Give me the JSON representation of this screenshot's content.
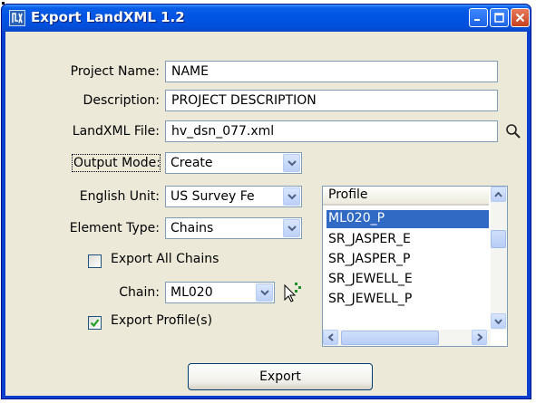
{
  "window": {
    "title": "Export LandXML 1.2"
  },
  "form": {
    "project_name": {
      "label": "Project Name:",
      "value": "NAME"
    },
    "description": {
      "label": "Description:",
      "value": "PROJECT DESCRIPTION"
    },
    "landxml_file": {
      "label": "LandXML File:",
      "value": "hv_dsn_077.xml"
    },
    "output_mode": {
      "label": "Output Mode:",
      "value": "Create"
    },
    "english_unit": {
      "label": "English Unit:",
      "value": "US Survey Fe"
    },
    "element_type": {
      "label": "Element Type:",
      "value": "Chains"
    },
    "export_all_chains": {
      "label": "Export All Chains",
      "checked": false
    },
    "chain": {
      "label": "Chain:",
      "value": "ML020"
    },
    "export_profiles": {
      "label": "Export Profile(s)",
      "checked": true
    }
  },
  "profile_list": {
    "header": "Profile",
    "items": [
      "ML020_P",
      "SR_JASPER_E",
      "SR_JASPER_P",
      "SR_JEWELL_E",
      "SR_JEWELL_P"
    ],
    "selected": "ML020_P"
  },
  "buttons": {
    "export": "Export"
  },
  "icons": {
    "app": "landxml-app-icon",
    "browse": "magnifier-icon",
    "pick": "pointer-pick-icon"
  },
  "colors": {
    "titlebar": "#0054e3",
    "selection": "#316ac5",
    "dialog_bg": "#ece9d8"
  }
}
